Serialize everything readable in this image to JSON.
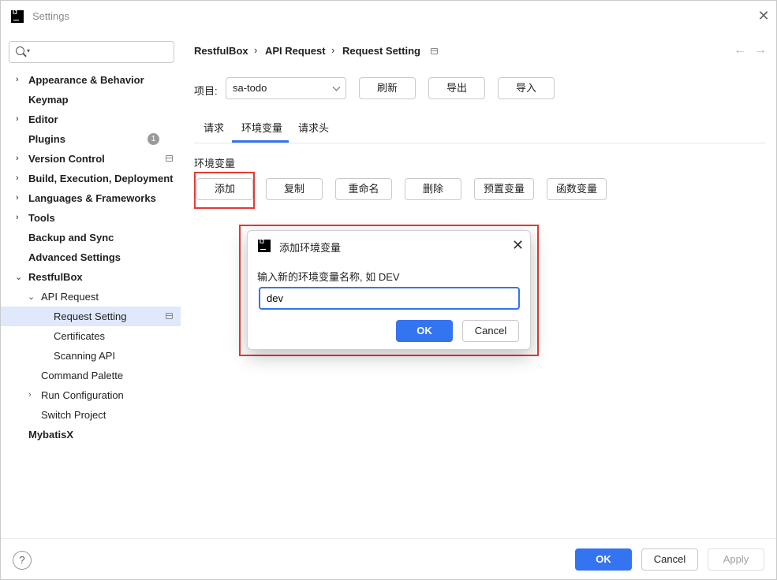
{
  "window": {
    "title": "Settings",
    "close_glyph": "✕",
    "logo_text": "IJ"
  },
  "search": {
    "placeholder": "",
    "value": ""
  },
  "sidebar": {
    "items": [
      {
        "label": "Appearance & Behavior",
        "expand": "collapsed"
      },
      {
        "label": "Keymap"
      },
      {
        "label": "Editor",
        "expand": "collapsed"
      },
      {
        "label": "Plugins",
        "badge": "1"
      },
      {
        "label": "Version Control",
        "expand": "collapsed"
      },
      {
        "label": "Build, Execution, Deployment",
        "expand": "collapsed"
      },
      {
        "label": "Languages & Frameworks",
        "expand": "collapsed"
      },
      {
        "label": "Tools",
        "expand": "collapsed"
      },
      {
        "label": "Backup and Sync"
      },
      {
        "label": "Advanced Settings"
      },
      {
        "label": "RestfulBox",
        "expand": "expanded"
      },
      {
        "label": "API Request",
        "expand": "expanded"
      },
      {
        "label": "Request Setting",
        "selected": true
      },
      {
        "label": "Certificates"
      },
      {
        "label": "Scanning API"
      },
      {
        "label": "Command Palette"
      },
      {
        "label": "Run Configuration",
        "expand": "collapsed"
      },
      {
        "label": "Switch Project"
      },
      {
        "label": "MybatisX"
      }
    ]
  },
  "breadcrumb": {
    "parts": [
      "RestfulBox",
      "API Request",
      "Request Setting"
    ],
    "sep": "›"
  },
  "nav": {
    "back": "←",
    "forward": "→"
  },
  "project": {
    "label": "项目:",
    "value": "sa-todo"
  },
  "toolbar": {
    "refresh": "刷新",
    "export": "导出",
    "import": "导入"
  },
  "tabs": [
    {
      "label": "请求"
    },
    {
      "label": "环境变量",
      "active": true
    },
    {
      "label": "请求头"
    }
  ],
  "env": {
    "section_label": "环境变量",
    "buttons": {
      "add": "添加",
      "copy": "复制",
      "rename": "重命名",
      "delete": "删除",
      "preset": "预置变量",
      "function": "函数变量"
    }
  },
  "dialog": {
    "title": "添加环境变量",
    "prompt": "输入新的环境变量名称, 如 DEV",
    "input_value": "dev",
    "ok": "OK",
    "cancel": "Cancel",
    "close_glyph": "✕"
  },
  "footer": {
    "help": "?",
    "ok": "OK",
    "cancel": "Cancel",
    "apply": "Apply"
  },
  "colors": {
    "accent": "#3574f0",
    "highlight": "#e53935",
    "selection": "#dfe9fb"
  }
}
